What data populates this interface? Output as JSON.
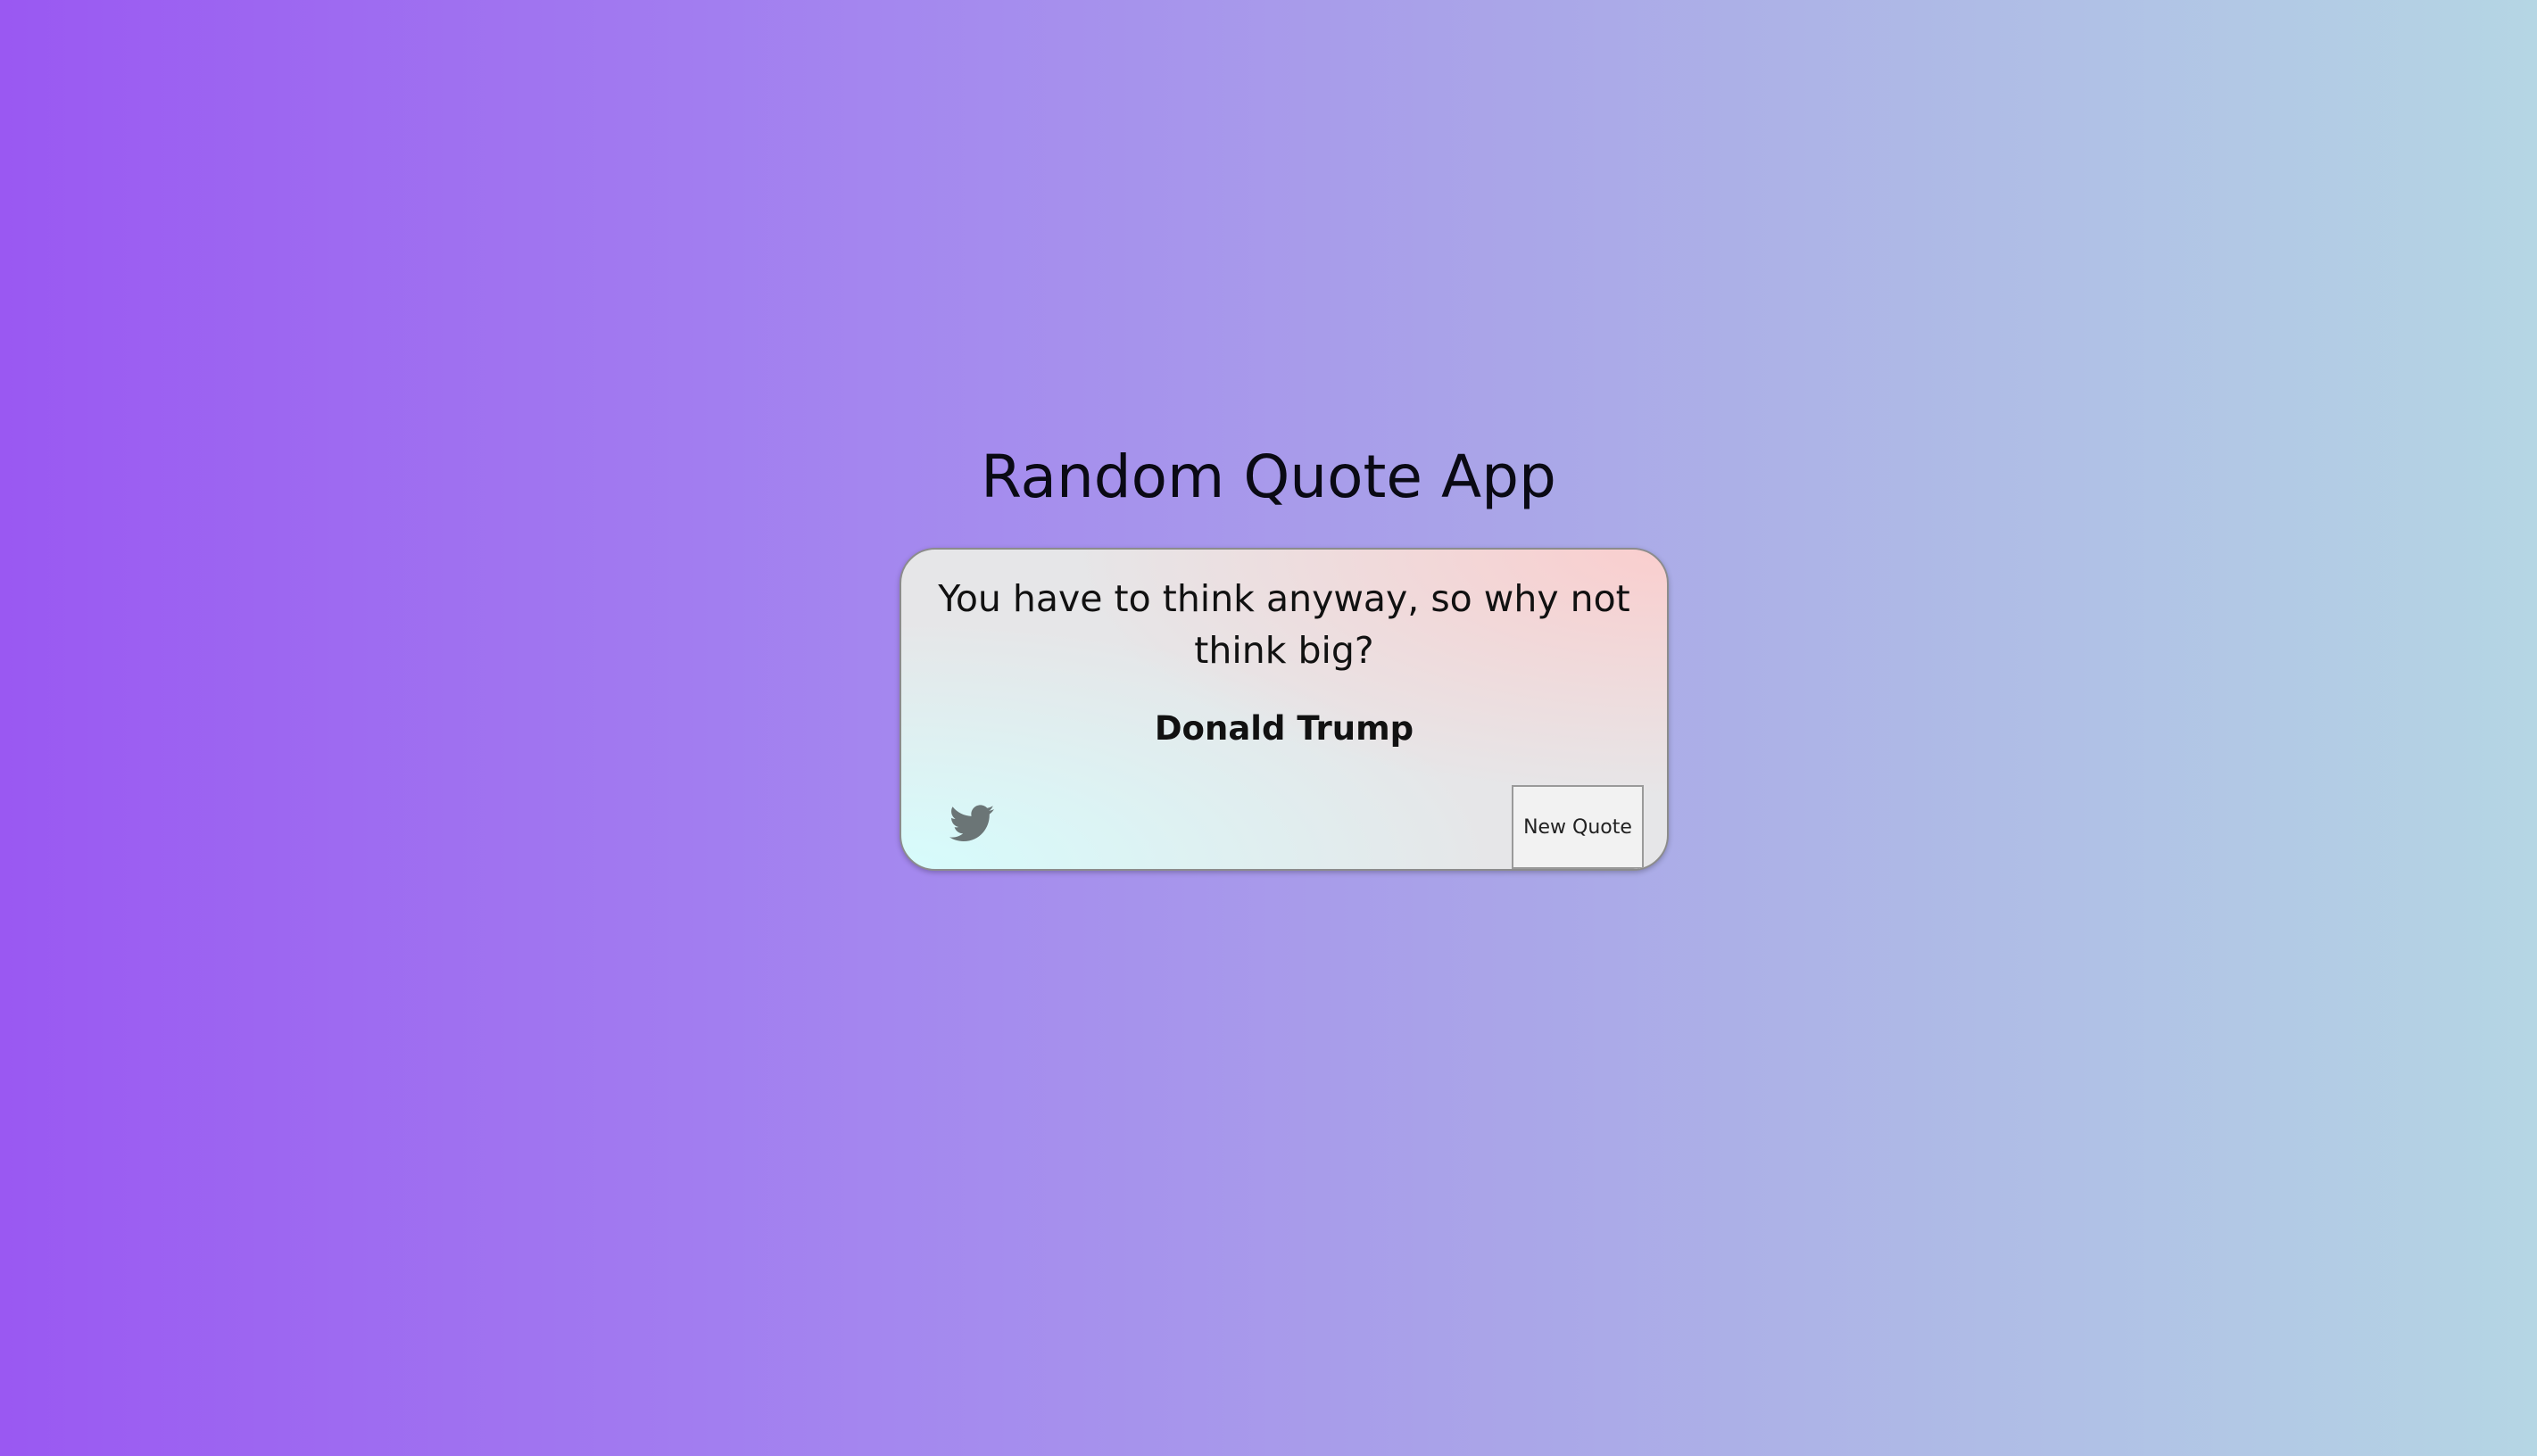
{
  "app": {
    "title": "Random Quote App"
  },
  "quote": {
    "text": "You have to think anyway, so why not think big?",
    "author": "Donald Trump"
  },
  "actions": {
    "tweet_icon": "twitter-bird-icon",
    "new_quote_label": "New Quote"
  },
  "colors": {
    "background_start": "#9a58f2",
    "background_end": "#b5d6e4",
    "icon": "#6b7576"
  }
}
